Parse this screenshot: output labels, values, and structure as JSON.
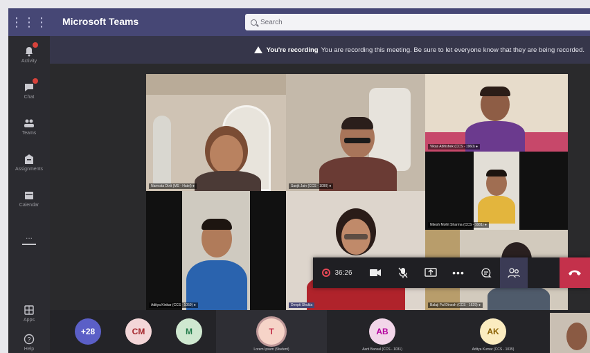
{
  "app": {
    "title": "Microsoft Teams"
  },
  "search": {
    "placeholder": "Search"
  },
  "rail": {
    "items": [
      {
        "label": "Activity",
        "icon": "bell-icon",
        "badge": true
      },
      {
        "label": "Chat",
        "icon": "chat-icon",
        "badge": true
      },
      {
        "label": "Teams",
        "icon": "teams-icon",
        "badge": false
      },
      {
        "label": "Assignments",
        "icon": "assignments-icon",
        "badge": false
      },
      {
        "label": "Calendar",
        "icon": "calendar-icon",
        "badge": false
      },
      {
        "label": "...",
        "icon": "more-icon",
        "badge": false
      },
      {
        "label": "Apps",
        "icon": "apps-icon",
        "badge": false
      },
      {
        "label": "Help",
        "icon": "help-icon",
        "badge": false
      }
    ]
  },
  "banner": {
    "bold": "You're recording",
    "text": "You are recording this meeting. Be sure to let everyone know that they are being recorded."
  },
  "tiles": [
    {
      "name": "Namrata Dixit (MS - Hatel) ●"
    },
    {
      "name": "Sanjit Jain (CCS - 1090) ●"
    },
    {
      "name": "Vikas Abhishek (CCS - 1960) ●"
    },
    {
      "name": "Aditya Kinkar (CCS - 1059) ●"
    },
    {
      "name": "Nitesh Mohit Sharma (CCS - 1081) ●"
    },
    {
      "name": "Deepti Shukla"
    },
    {
      "name": "Balaji Pal Dinesh (CCS - 1629) ●"
    }
  ],
  "controls": {
    "timer": "36:26",
    "buttons": [
      "camera-icon",
      "mic-off-icon",
      "share-screen-icon",
      "more-icon",
      "chat-icon",
      "participants-icon"
    ],
    "hangup": "hang-up-icon"
  },
  "strip": {
    "participants": [
      {
        "initials": "+28",
        "name": "",
        "bg": "#5b5fc7",
        "fg": "#ffffff"
      },
      {
        "initials": "CM",
        "name": "",
        "bg": "#f3d6d8",
        "fg": "#a4262c"
      },
      {
        "initials": "M",
        "name": "",
        "bg": "#cfe8d0",
        "fg": "#237b4b"
      },
      {
        "initials": "T",
        "name": "Lorem Ipsum (Student)",
        "bg": "#f6d4c8",
        "fg": "#c4314b"
      },
      {
        "initials": "AB",
        "name": "Aarti Bansal (CCS - 1031)",
        "bg": "#f2d6e9",
        "fg": "#b4009e"
      },
      {
        "initials": "AK",
        "name": "Aditya Kumar (CCS - 1035)",
        "bg": "#fbecc0",
        "fg": "#8a6000"
      }
    ]
  },
  "colors": {
    "titlebar": "#464775",
    "banner": "#36364a",
    "hangup": "#c4314b",
    "stage": "#2a2a2c"
  }
}
